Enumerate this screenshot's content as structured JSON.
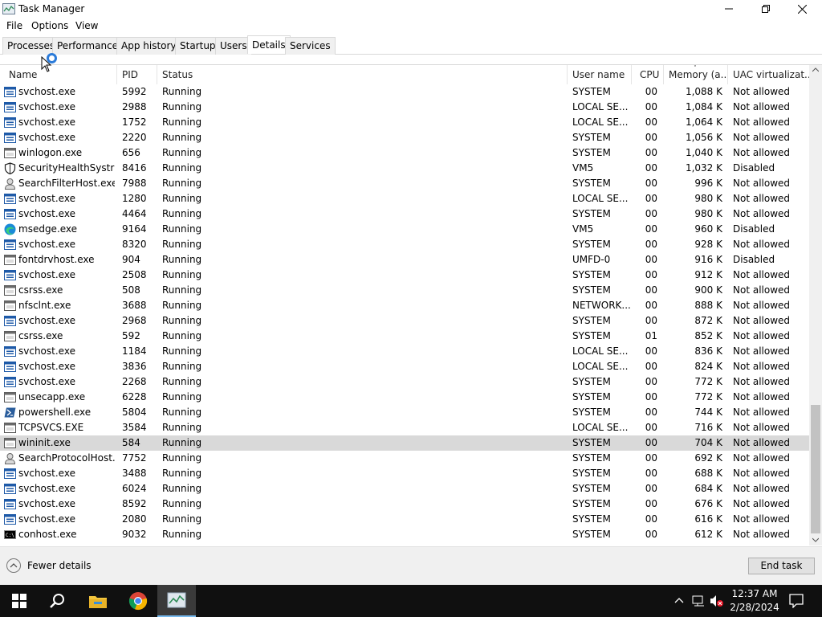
{
  "window": {
    "title": "Task Manager",
    "icon": "task-manager-icon"
  },
  "menu": [
    "File",
    "Options",
    "View"
  ],
  "tabs": [
    "Processes",
    "Performance",
    "App history",
    "Startup",
    "Users",
    "Details",
    "Services"
  ],
  "active_tab": "Details",
  "columns": {
    "name": "Name",
    "pid": "PID",
    "status": "Status",
    "user": "User name",
    "cpu": "CPU",
    "memory": "Memory (a...",
    "uac": "UAC virtualizat..."
  },
  "rows": [
    {
      "icon": "service-host-icon",
      "name": "svchost.exe",
      "pid": "5992",
      "status": "Running",
      "user": "SYSTEM",
      "cpu": "00",
      "memory": "1,088 K",
      "uac": "Not allowed"
    },
    {
      "icon": "service-host-icon",
      "name": "svchost.exe",
      "pid": "2988",
      "status": "Running",
      "user": "LOCAL SE...",
      "cpu": "00",
      "memory": "1,084 K",
      "uac": "Not allowed"
    },
    {
      "icon": "service-host-icon",
      "name": "svchost.exe",
      "pid": "1752",
      "status": "Running",
      "user": "LOCAL SE...",
      "cpu": "00",
      "memory": "1,064 K",
      "uac": "Not allowed"
    },
    {
      "icon": "service-host-icon",
      "name": "svchost.exe",
      "pid": "2220",
      "status": "Running",
      "user": "SYSTEM",
      "cpu": "00",
      "memory": "1,056 K",
      "uac": "Not allowed"
    },
    {
      "icon": "window-app-icon",
      "name": "winlogon.exe",
      "pid": "656",
      "status": "Running",
      "user": "SYSTEM",
      "cpu": "00",
      "memory": "1,040 K",
      "uac": "Not allowed"
    },
    {
      "icon": "shield-icon",
      "name": "SecurityHealthSystra...",
      "pid": "8416",
      "status": "Running",
      "user": "VM5",
      "cpu": "00",
      "memory": "1,032 K",
      "uac": "Disabled"
    },
    {
      "icon": "search-user-icon",
      "name": "SearchFilterHost.exe",
      "pid": "7988",
      "status": "Running",
      "user": "SYSTEM",
      "cpu": "00",
      "memory": "996 K",
      "uac": "Not allowed"
    },
    {
      "icon": "service-host-icon",
      "name": "svchost.exe",
      "pid": "1280",
      "status": "Running",
      "user": "LOCAL SE...",
      "cpu": "00",
      "memory": "980 K",
      "uac": "Not allowed"
    },
    {
      "icon": "service-host-icon",
      "name": "svchost.exe",
      "pid": "4464",
      "status": "Running",
      "user": "SYSTEM",
      "cpu": "00",
      "memory": "980 K",
      "uac": "Not allowed"
    },
    {
      "icon": "edge-icon",
      "name": "msedge.exe",
      "pid": "9164",
      "status": "Running",
      "user": "VM5",
      "cpu": "00",
      "memory": "960 K",
      "uac": "Disabled"
    },
    {
      "icon": "service-host-icon",
      "name": "svchost.exe",
      "pid": "8320",
      "status": "Running",
      "user": "SYSTEM",
      "cpu": "00",
      "memory": "928 K",
      "uac": "Not allowed"
    },
    {
      "icon": "window-app-icon",
      "name": "fontdrvhost.exe",
      "pid": "904",
      "status": "Running",
      "user": "UMFD-0",
      "cpu": "00",
      "memory": "916 K",
      "uac": "Disabled"
    },
    {
      "icon": "service-host-icon",
      "name": "svchost.exe",
      "pid": "2508",
      "status": "Running",
      "user": "SYSTEM",
      "cpu": "00",
      "memory": "912 K",
      "uac": "Not allowed"
    },
    {
      "icon": "window-app-icon",
      "name": "csrss.exe",
      "pid": "508",
      "status": "Running",
      "user": "SYSTEM",
      "cpu": "00",
      "memory": "900 K",
      "uac": "Not allowed"
    },
    {
      "icon": "window-app-icon",
      "name": "nfsclnt.exe",
      "pid": "3688",
      "status": "Running",
      "user": "NETWORK...",
      "cpu": "00",
      "memory": "888 K",
      "uac": "Not allowed"
    },
    {
      "icon": "service-host-icon",
      "name": "svchost.exe",
      "pid": "2968",
      "status": "Running",
      "user": "SYSTEM",
      "cpu": "00",
      "memory": "872 K",
      "uac": "Not allowed"
    },
    {
      "icon": "window-app-icon",
      "name": "csrss.exe",
      "pid": "592",
      "status": "Running",
      "user": "SYSTEM",
      "cpu": "01",
      "memory": "852 K",
      "uac": "Not allowed"
    },
    {
      "icon": "service-host-icon",
      "name": "svchost.exe",
      "pid": "1184",
      "status": "Running",
      "user": "LOCAL SE...",
      "cpu": "00",
      "memory": "836 K",
      "uac": "Not allowed"
    },
    {
      "icon": "service-host-icon",
      "name": "svchost.exe",
      "pid": "3836",
      "status": "Running",
      "user": "LOCAL SE...",
      "cpu": "00",
      "memory": "824 K",
      "uac": "Not allowed"
    },
    {
      "icon": "service-host-icon",
      "name": "svchost.exe",
      "pid": "2268",
      "status": "Running",
      "user": "SYSTEM",
      "cpu": "00",
      "memory": "772 K",
      "uac": "Not allowed"
    },
    {
      "icon": "window-app-icon",
      "name": "unsecapp.exe",
      "pid": "6228",
      "status": "Running",
      "user": "SYSTEM",
      "cpu": "00",
      "memory": "772 K",
      "uac": "Not allowed"
    },
    {
      "icon": "powershell-icon",
      "name": "powershell.exe",
      "pid": "5804",
      "status": "Running",
      "user": "SYSTEM",
      "cpu": "00",
      "memory": "744 K",
      "uac": "Not allowed"
    },
    {
      "icon": "window-app-icon",
      "name": "TCPSVCS.EXE",
      "pid": "3584",
      "status": "Running",
      "user": "LOCAL SE...",
      "cpu": "00",
      "memory": "716 K",
      "uac": "Not allowed"
    },
    {
      "icon": "window-app-icon",
      "name": "wininit.exe",
      "pid": "584",
      "status": "Running",
      "user": "SYSTEM",
      "cpu": "00",
      "memory": "704 K",
      "uac": "Not allowed",
      "selected": true
    },
    {
      "icon": "search-user-icon",
      "name": "SearchProtocolHost....",
      "pid": "7752",
      "status": "Running",
      "user": "SYSTEM",
      "cpu": "00",
      "memory": "692 K",
      "uac": "Not allowed"
    },
    {
      "icon": "service-host-icon",
      "name": "svchost.exe",
      "pid": "3488",
      "status": "Running",
      "user": "SYSTEM",
      "cpu": "00",
      "memory": "688 K",
      "uac": "Not allowed"
    },
    {
      "icon": "service-host-icon",
      "name": "svchost.exe",
      "pid": "6024",
      "status": "Running",
      "user": "SYSTEM",
      "cpu": "00",
      "memory": "684 K",
      "uac": "Not allowed"
    },
    {
      "icon": "service-host-icon",
      "name": "svchost.exe",
      "pid": "8592",
      "status": "Running",
      "user": "SYSTEM",
      "cpu": "00",
      "memory": "676 K",
      "uac": "Not allowed"
    },
    {
      "icon": "service-host-icon",
      "name": "svchost.exe",
      "pid": "2080",
      "status": "Running",
      "user": "SYSTEM",
      "cpu": "00",
      "memory": "616 K",
      "uac": "Not allowed"
    },
    {
      "icon": "console-icon",
      "name": "conhost.exe",
      "pid": "9032",
      "status": "Running",
      "user": "SYSTEM",
      "cpu": "00",
      "memory": "612 K",
      "uac": "Not allowed"
    }
  ],
  "footer": {
    "fewer_details": "Fewer details",
    "end_task": "End task"
  },
  "taskbar": {
    "apps": [
      "windows-start-icon",
      "search-icon",
      "file-explorer-icon",
      "chrome-icon",
      "task-manager-icon"
    ],
    "time": "12:37 AM",
    "date": "2/28/2024"
  },
  "colors": {
    "selected_row": "#d9d9d9",
    "taskbar": "#101010",
    "accent": "#2b7bd9"
  }
}
